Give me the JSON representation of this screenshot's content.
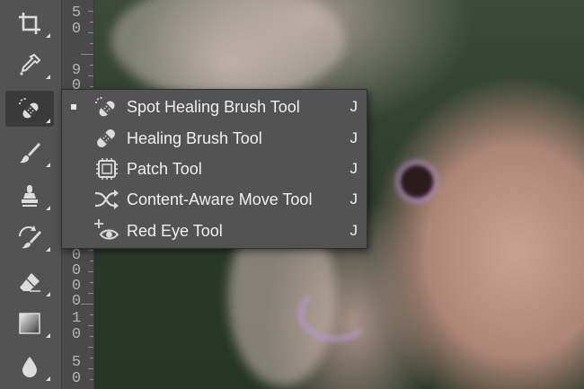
{
  "toolbar": {
    "tools": [
      {
        "name": "crop-tool",
        "icon": "crop-icon"
      },
      {
        "name": "eyedropper-tool",
        "icon": "eyedropper-icon"
      },
      {
        "name": "spot-healing-brush-tool",
        "icon": "spot-healing-brush-icon",
        "active": true
      },
      {
        "name": "brush-tool",
        "icon": "brush-icon"
      },
      {
        "name": "clone-stamp-tool",
        "icon": "clone-stamp-icon"
      },
      {
        "name": "history-brush-tool",
        "icon": "history-brush-icon"
      },
      {
        "name": "eraser-tool",
        "icon": "eraser-icon"
      },
      {
        "name": "gradient-tool",
        "icon": "gradient-icon"
      },
      {
        "name": "blur-tool",
        "icon": "blur-drop-icon"
      }
    ]
  },
  "ruler": {
    "labels": [
      {
        "id": "r1",
        "text": "5"
      },
      {
        "id": "r2",
        "text": "0"
      },
      {
        "id": "r3",
        "text": "9"
      },
      {
        "id": "r4",
        "text": "0"
      },
      {
        "id": "r5",
        "text": "0"
      },
      {
        "id": "r6",
        "text": "0"
      },
      {
        "id": "r7",
        "text": "0"
      },
      {
        "id": "r8",
        "text": "0"
      },
      {
        "id": "r9",
        "text": "1"
      },
      {
        "id": "r10",
        "text": "0"
      },
      {
        "id": "r11",
        "text": "5"
      },
      {
        "id": "r12",
        "text": "0"
      }
    ]
  },
  "flyout": {
    "items": [
      {
        "label": "Spot Healing Brush Tool",
        "shortcut": "J",
        "selected": true,
        "icon": "spot-healing-brush-icon"
      },
      {
        "label": "Healing Brush Tool",
        "shortcut": "J",
        "selected": false,
        "icon": "healing-brush-icon"
      },
      {
        "label": "Patch Tool",
        "shortcut": "J",
        "selected": false,
        "icon": "patch-icon"
      },
      {
        "label": "Content-Aware Move Tool",
        "shortcut": "J",
        "selected": false,
        "icon": "content-aware-move-icon"
      },
      {
        "label": "Red Eye Tool",
        "shortcut": "J",
        "selected": false,
        "icon": "red-eye-icon"
      }
    ]
  },
  "colors": {
    "panel": "#535353",
    "text": "#f0f0f0",
    "icon": "#dcdcdc"
  }
}
